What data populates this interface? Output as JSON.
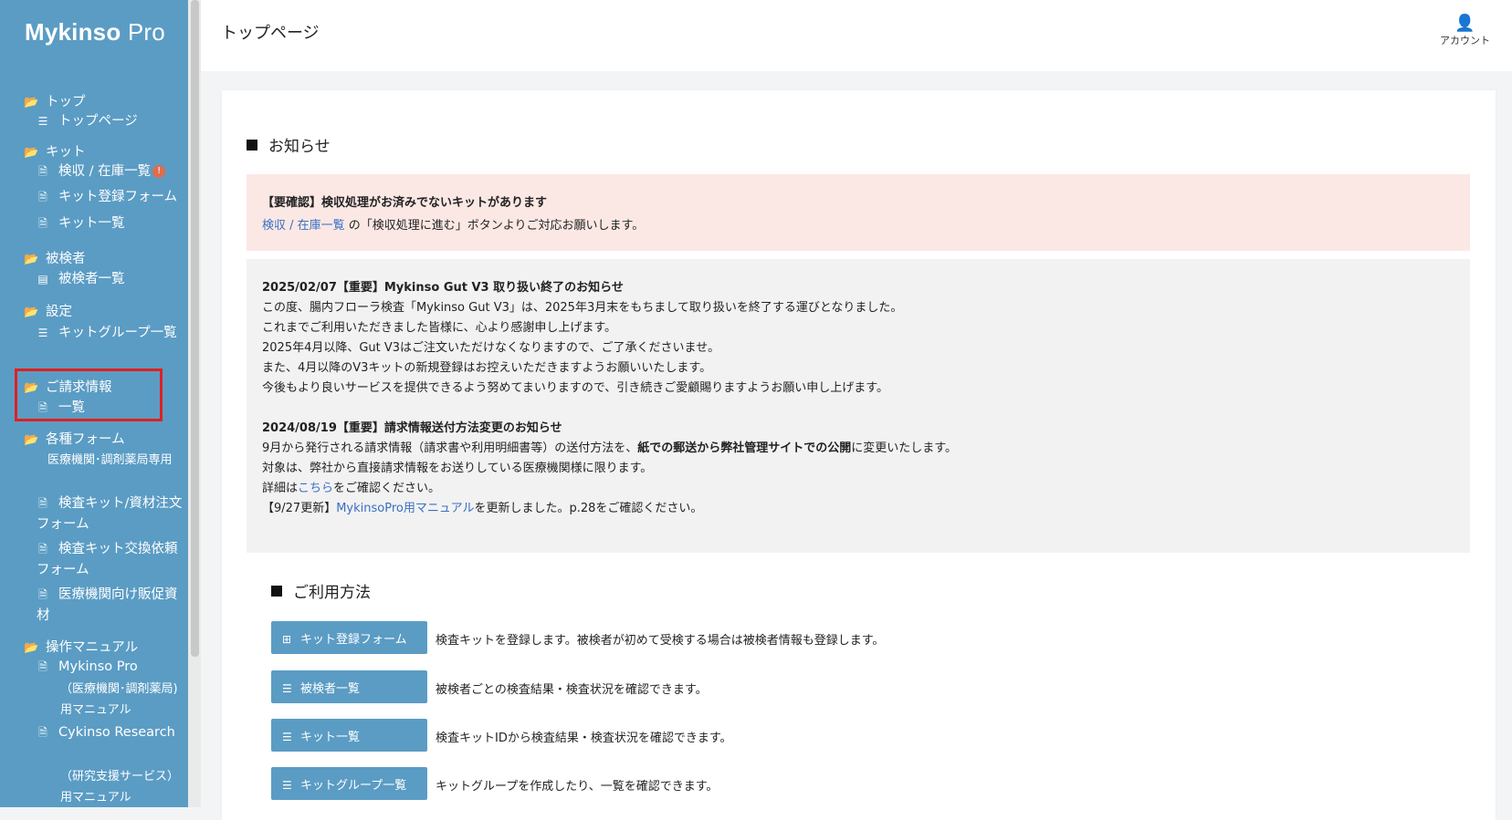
{
  "brand": {
    "name_bold": "Mykinso",
    "name_light": " Pro"
  },
  "header": {
    "title": "トップページ",
    "account_label": "アカウント"
  },
  "sidebar": {
    "sections": [
      {
        "label": "トップ",
        "items": [
          {
            "label": "トップページ"
          }
        ]
      },
      {
        "label": "キット",
        "items": [
          {
            "label": "検収 / 在庫一覧",
            "badge": "!"
          },
          {
            "label": "キット登録フォーム"
          },
          {
            "label": "キット一覧"
          }
        ]
      },
      {
        "label": "被検者",
        "items": [
          {
            "label": "被検者一覧"
          }
        ]
      },
      {
        "label": "設定",
        "items": [
          {
            "label": "キットグループ一覧"
          }
        ]
      },
      {
        "label": "ご請求情報",
        "items": [
          {
            "label": "一覧"
          }
        ]
      },
      {
        "label": "各種フォーム",
        "subheading": "医療機関･調剤薬局専用",
        "items": [
          {
            "label": "検査キット/資材注文フォーム"
          },
          {
            "label": "検査キット交換依頼フォーム"
          },
          {
            "label": "医療機関向け販促資材"
          }
        ]
      },
      {
        "label": "操作マニュアル",
        "items": [
          {
            "label": "Mykinso Pro",
            "sub": "（医療機関･調剤薬局)用マニュアル"
          },
          {
            "label": "Cykinso Research",
            "sub": "（研究支援サービス）用マニュアル"
          }
        ]
      }
    ]
  },
  "notices": {
    "heading": "お知らせ",
    "alert": {
      "title": "【要確認】検収処理がお済みでないキットがあります",
      "link": "検収 / 在庫一覧",
      "text": " の「検収処理に進む」ボタンよりご対応お願いします。"
    },
    "news": [
      {
        "title": "2025/02/07【重要】Mykinso Gut V3 取り扱い終了のお知らせ",
        "lines": [
          "この度、腸内フローラ検査「Mykinso Gut V3」は、2025年3月末をもちまして取り扱いを終了する運びとなりました。",
          "これまでご利用いただきました皆様に、心より感謝申し上げます。",
          "2025年4月以降、Gut V3はご注文いただけなくなりますので、ご了承くださいませ。",
          "また、4月以降のV3キットの新規登録はお控えいただきますようお願いいたします。",
          "今後もより良いサービスを提供できるよう努めてまいりますので、引き続きご愛顧賜りますようお願い申し上げます。"
        ]
      },
      {
        "title": "2024/08/19【重要】請求情報送付方法変更のお知らせ",
        "line1_pre": "9月から発行される請求情報（請求書や利用明細書等）の送付方法を、",
        "line1_bold": "紙での郵送から弊社管理サイトでの公開",
        "line1_post": "に変更いたします。",
        "line2": "対象は、弊社から直接請求情報をお送りしている医療機関様に限ります。",
        "line3_pre": "詳細は",
        "line3_link": "こちら",
        "line3_post": "をご確認ください。",
        "line4_pre": "【9/27更新】",
        "line4_link": "MykinsoPro用マニュアル",
        "line4_post": "を更新しました。p.28をご確認ください。"
      }
    ]
  },
  "usage": {
    "heading": "ご利用方法",
    "rows": [
      {
        "button": "キット登録フォーム",
        "icon": "plus-file-icon",
        "desc": "検査キットを登録します。被検者が初めて受検する場合は被検者情報も登録します。"
      },
      {
        "button": "被検者一覧",
        "icon": "list-icon",
        "desc": "被検者ごとの検査結果・検査状況を確認できます。"
      },
      {
        "button": "キット一覧",
        "icon": "list-icon",
        "desc": "検査キットIDから検査結果・検査状況を確認できます。"
      },
      {
        "button": "キットグループ一覧",
        "icon": "list-icon",
        "desc": "キットグループを作成したり、一覧を確認できます。"
      }
    ]
  },
  "colors": {
    "sidebar": "#5b9cc4",
    "alert_bg": "#fbe8e4",
    "highlight": "#e02020",
    "badge": "#e06c4d"
  }
}
